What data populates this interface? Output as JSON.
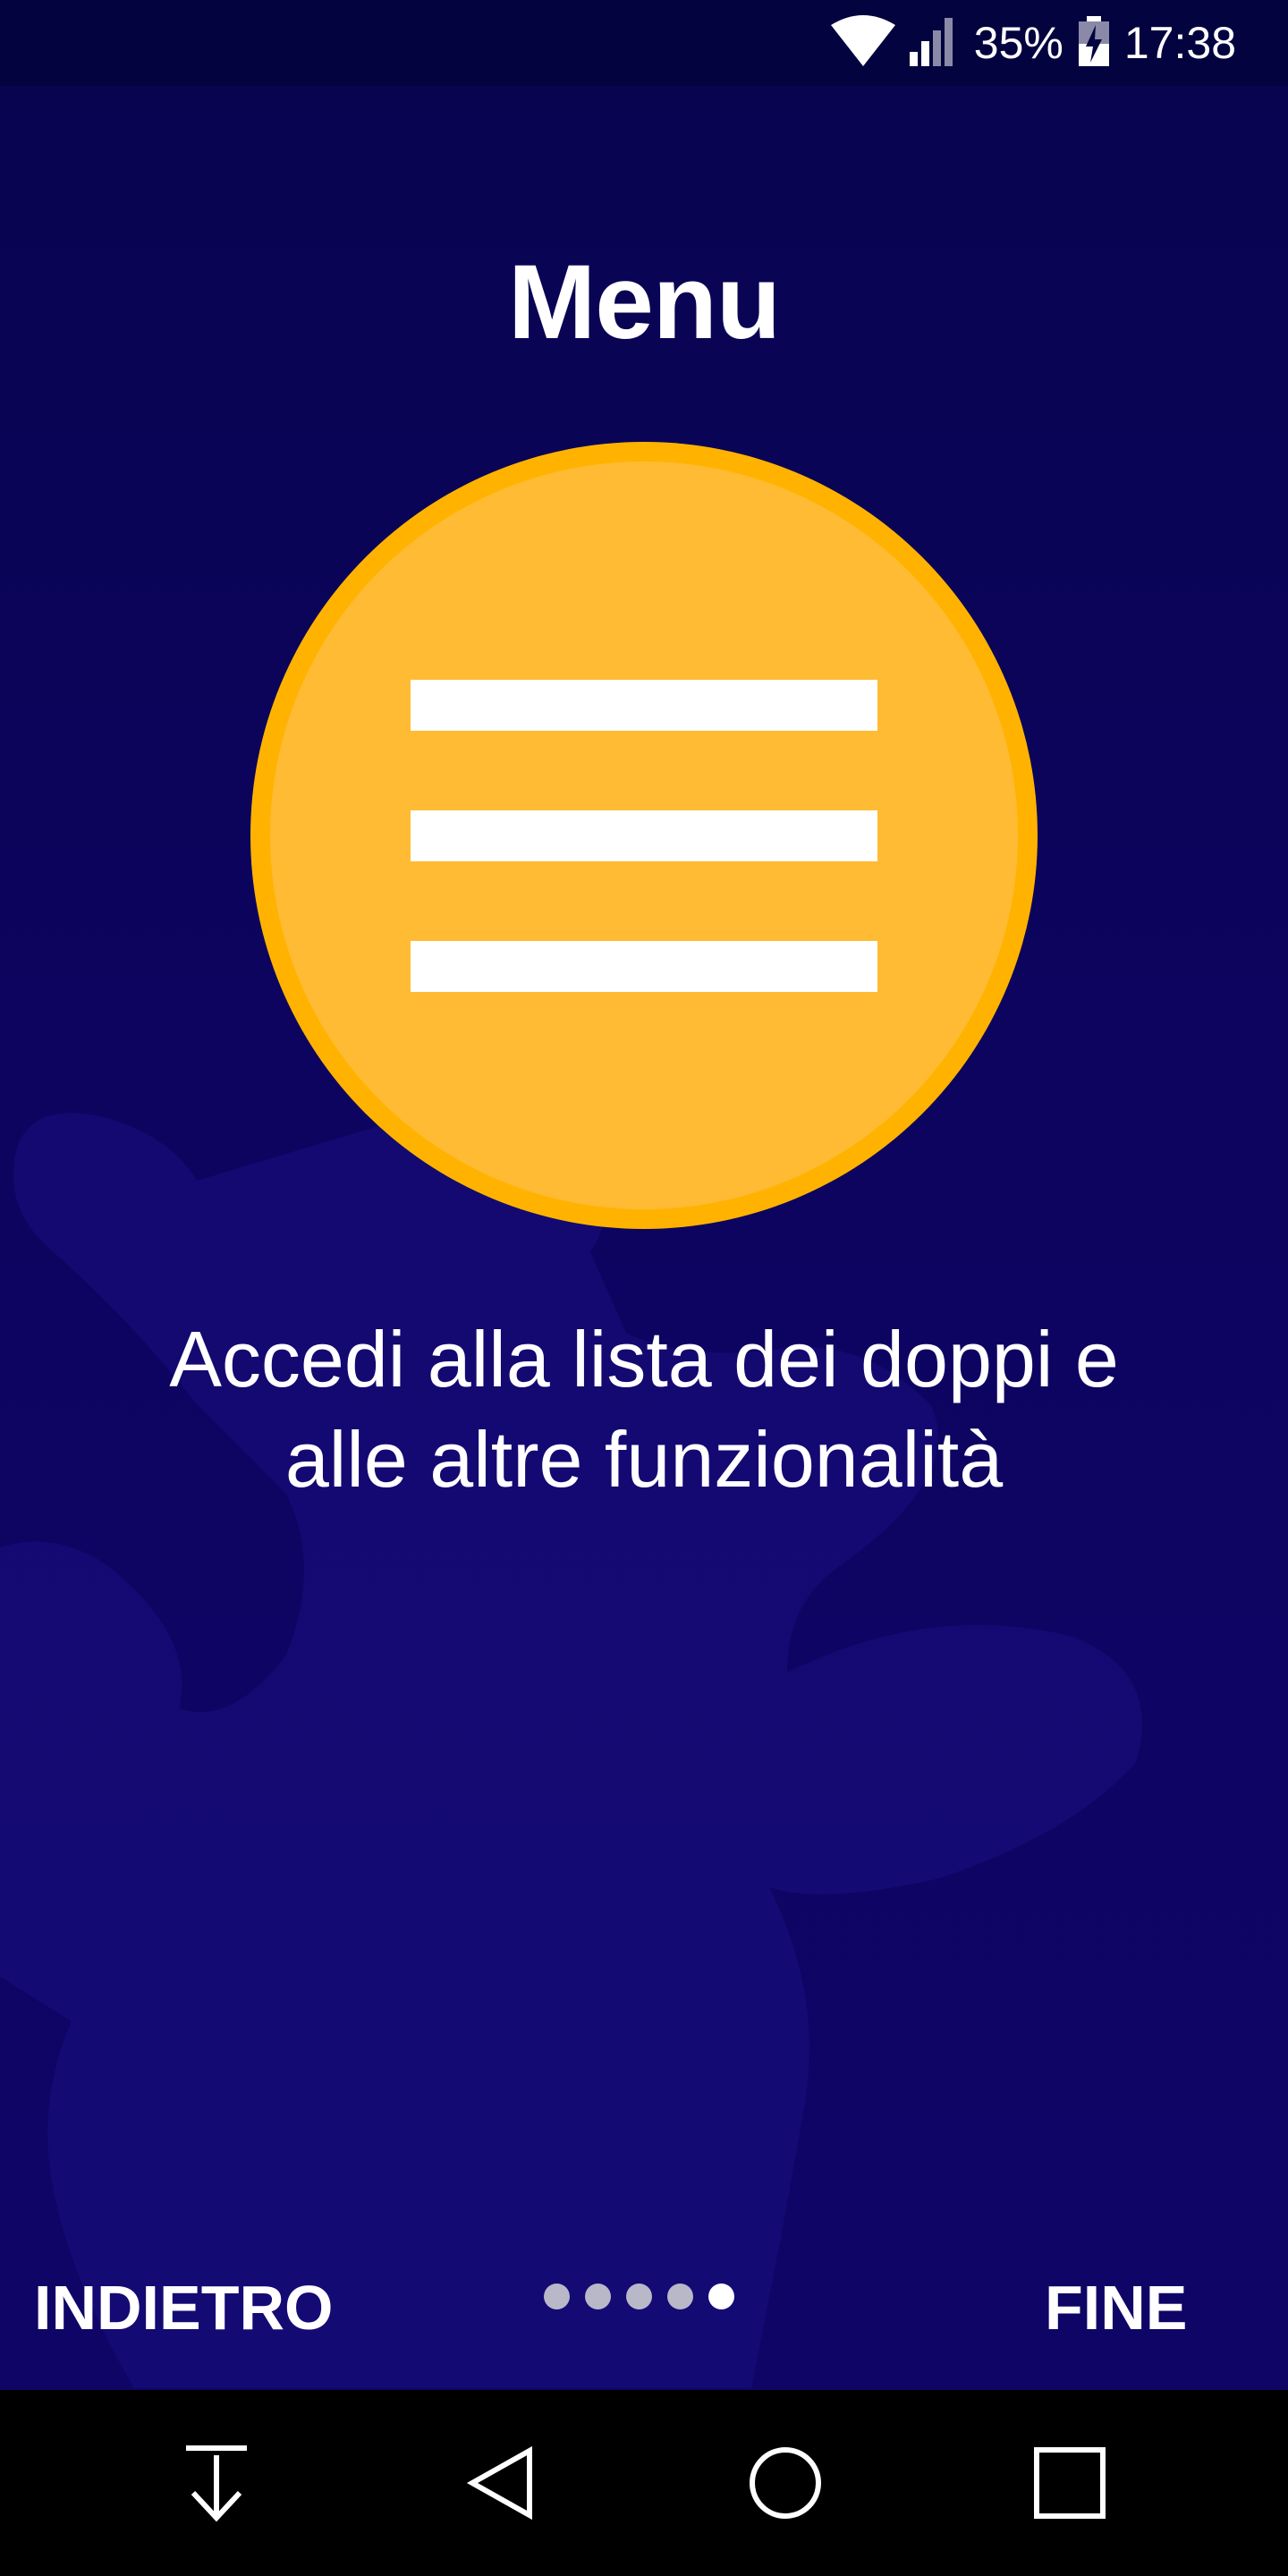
{
  "status_bar": {
    "battery": "35%",
    "time": "17:38",
    "icons": [
      "wifi-icon",
      "signal-icon",
      "battery-charging-icon"
    ]
  },
  "page": {
    "title": "Menu",
    "description_line1": "Accedi alla lista dei doppi e",
    "description_line2": "alle altre funzionalità",
    "illustration_icon": "hamburger-menu-icon"
  },
  "controls": {
    "back_label": "INDIETRO",
    "done_label": "FINE",
    "pager": {
      "total_pages": 5,
      "current_page": 5
    }
  },
  "nav_bar": {
    "icons": [
      "download-icon",
      "back-triangle-icon",
      "home-circle-icon",
      "recents-square-icon"
    ]
  },
  "colors": {
    "background": "#0d0460",
    "status_bar": "#03033f",
    "circle_outer": "#ffb300",
    "circle_inner": "#ffbb33",
    "text": "#ffffff",
    "dot_inactive": "#b8b8c8"
  }
}
